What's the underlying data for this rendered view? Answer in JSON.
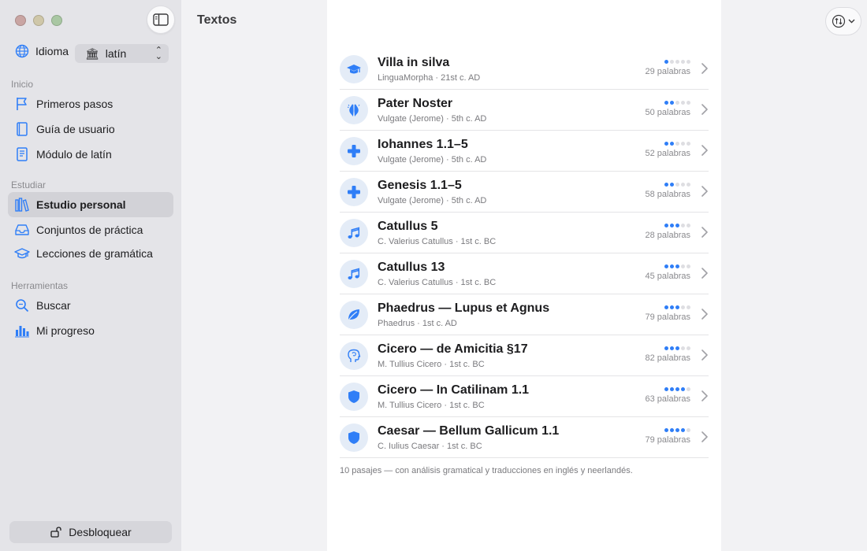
{
  "window": {
    "title": "Textos"
  },
  "sidebar": {
    "language": {
      "label": "Idioma",
      "value": "latín",
      "flag": "🏛"
    },
    "sections": [
      {
        "title": "Inicio",
        "items": [
          {
            "label": "Primeros pasos",
            "icon": "flag-icon"
          },
          {
            "label": "Guía de usuario",
            "icon": "book-icon"
          },
          {
            "label": "Módulo de latín",
            "icon": "document-icon"
          }
        ]
      },
      {
        "title": "Estudiar",
        "items": [
          {
            "label": "Estudio personal",
            "icon": "library-icon",
            "active": true
          },
          {
            "label": "Conjuntos de práctica",
            "icon": "tray-icon"
          },
          {
            "label": "Lecciones de gramática",
            "icon": "graduation-cap-icon"
          }
        ]
      },
      {
        "title": "Herramientas",
        "items": [
          {
            "label": "Buscar",
            "icon": "search-icon"
          },
          {
            "label": "Mi progreso",
            "icon": "bar-chart-icon"
          }
        ]
      }
    ],
    "unlock_label": "Desbloquear"
  },
  "texts": [
    {
      "title": "Villa in silva",
      "source": "LinguaMorpha · 21st c. AD",
      "words": "29 palabras",
      "level": 1,
      "icon": "graduation-cap-icon"
    },
    {
      "title": "Pater Noster",
      "source": "Vulgate (Jerome) · 5th c. AD",
      "words": "50 palabras",
      "level": 2,
      "icon": "praying-hands-icon"
    },
    {
      "title": "Iohannes 1.1–5",
      "source": "Vulgate (Jerome) · 5th c. AD",
      "words": "52 palabras",
      "level": 2,
      "icon": "cross-icon"
    },
    {
      "title": "Genesis 1.1–5",
      "source": "Vulgate (Jerome) · 5th c. AD",
      "words": "58 palabras",
      "level": 2,
      "icon": "cross-icon"
    },
    {
      "title": "Catullus 5",
      "source": "C. Valerius Catullus · 1st c. BC",
      "words": "28 palabras",
      "level": 3,
      "icon": "music-notes-icon"
    },
    {
      "title": "Catullus 13",
      "source": "C. Valerius Catullus · 1st c. BC",
      "words": "45 palabras",
      "level": 3,
      "icon": "music-notes-icon"
    },
    {
      "title": "Phaedrus — Lupus et Agnus",
      "source": "Phaedrus · 1st c. AD",
      "words": "79 palabras",
      "level": 3,
      "icon": "leaf-icon"
    },
    {
      "title": "Cicero — de Amicitia §17",
      "source": "M. Tullius Cicero · 1st c. BC",
      "words": "82 palabras",
      "level": 3,
      "icon": "head-profile-icon"
    },
    {
      "title": "Cicero — In Catilinam 1.1",
      "source": "M. Tullius Cicero · 1st c. BC",
      "words": "63 palabras",
      "level": 4,
      "icon": "shield-icon"
    },
    {
      "title": "Caesar — Bellum Gallicum 1.1",
      "source": "C. Iulius Caesar · 1st c. BC",
      "words": "79 palabras",
      "level": 4,
      "icon": "shield-icon"
    }
  ],
  "footer_note": "10 pasajes — con análisis gramatical y traducciones en inglés y neerlandés.",
  "colors": {
    "accent": "#2f7ef7",
    "icon_bg": "#e4ecf7",
    "dot_off": "#dedee2"
  }
}
